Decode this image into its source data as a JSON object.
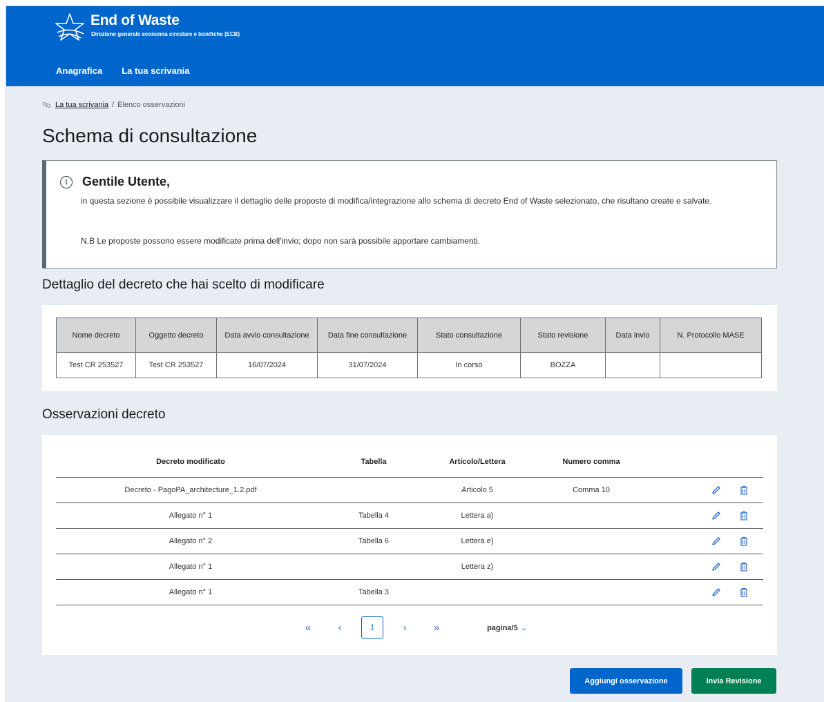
{
  "header": {
    "title": "End of Waste",
    "subtitle": "Direzione generale economia circolare e bonifiche (ECB)",
    "nav": [
      "Anagrafica",
      "La tua scrivania"
    ]
  },
  "breadcrumb": {
    "link": "La tua scrivania",
    "separator": "/",
    "current": "Elenco osservazioni"
  },
  "page_title": "Schema di consultazione",
  "info": {
    "title": "Gentile Utente,",
    "body": "in questa sezione è possibile visualizzare il dettaglio delle proposte di modifica/integrazione allo schema di decreto End of Waste selezionato, che risultano create e salvate.",
    "note": "N.B Le proposte possono essere modificate prima dell'invio; dopo non sarà possibile apportare cambiamenti."
  },
  "detail": {
    "heading": "Dettaglio del decreto che hai scelto di modificare",
    "columns": [
      "Nome decreto",
      "Oggetto decreto",
      "Data avvio consultazione",
      "Data fine consultazione",
      "Stato consultazione",
      "Stato revisione",
      "Data invio",
      "N. Protocollo MASE"
    ],
    "row": [
      "Test CR 253527",
      "Test CR 253527",
      "16/07/2024",
      "31/07/2024",
      "In corso",
      "BOZZA",
      "",
      ""
    ]
  },
  "observations": {
    "heading": "Osservazioni decreto",
    "columns": [
      "Decreto modificato",
      "Tabella",
      "Articolo/Lettera",
      "Numero comma"
    ],
    "rows": [
      [
        "Decreto - PagoPA_architecture_1.2.pdf",
        "",
        "Articolo 5",
        "Comma 10"
      ],
      [
        "Allegato n° 1",
        "Tabella 4",
        "Lettera a)",
        ""
      ],
      [
        "Allegato n° 2",
        "Tabella 6",
        "Lettera e)",
        ""
      ],
      [
        "Allegato n° 1",
        "",
        "Lettera z)",
        ""
      ],
      [
        "Allegato n° 1",
        "Tabella 3",
        "",
        ""
      ]
    ]
  },
  "pagination": {
    "first": "«",
    "prev": "‹",
    "current": "1",
    "next": "›",
    "last": "»",
    "page_select": "pagina/5"
  },
  "actions": {
    "add": "Aggiungi osservazione",
    "send": "Invia Revisione"
  },
  "colors": {
    "primary": "#0066cc",
    "success": "#008055",
    "background": "#e8edf3"
  }
}
